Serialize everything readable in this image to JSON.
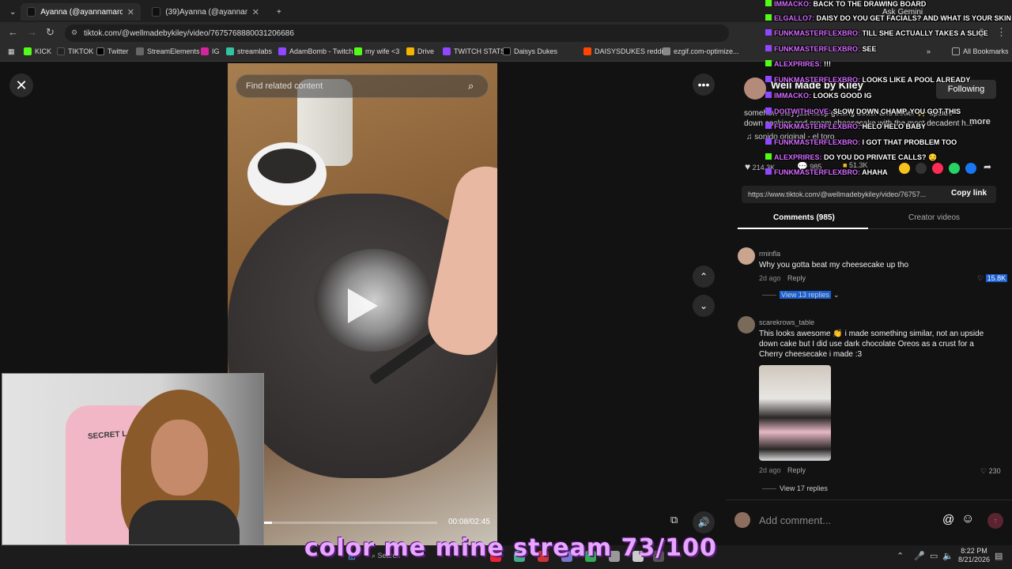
{
  "browser": {
    "tabs": [
      {
        "label": "Ayanna (@ayannamarcelin) | Ti",
        "active": true
      },
      {
        "label": "(39)Ayanna (@ayannamarcelin)",
        "active": false
      }
    ],
    "url": "tiktok.com/@wellmadebykiley/video/7675768880031206686",
    "ask_gemini": "Ask Gemini",
    "bookmarks": [
      "KICK",
      "TIKTOK",
      "Twitter",
      "StreamElements",
      "IG",
      "streamlabs",
      "AdamBomb - Twitch",
      "my wife <3",
      "Drive",
      "TWITCH STATS",
      "Daisys Dukes",
      "DAISYSDUKES reddit",
      "ezgif.com-optimize...",
      "All Bookmarks"
    ]
  },
  "video": {
    "search_placeholder": "Find related content",
    "time": "00:08/02:45",
    "progress": 0.05
  },
  "post": {
    "author": "Well Made by Kiley",
    "follow_label": "Following",
    "description": "somehow they just keep getting better and better ✨ upside-down cookies and cream cheesecake with the most decadent h...",
    "more": "more",
    "sound": "sonido original - el toro",
    "likes": "214.3K",
    "comments_count": "985",
    "saves": "51.3K",
    "link": "https://www.tiktok.com/@wellmadebykiley/video/76757...",
    "copy_link": "Copy link",
    "tab_comments": "Comments (985)",
    "tab_creator": "Creator videos"
  },
  "comments": [
    {
      "user": "rminfla",
      "text": "Why you gotta beat my cheesecake up tho",
      "date": "2d ago",
      "reply": "Reply",
      "likes": "15.8K",
      "replies": "View 13 replies"
    },
    {
      "user": "scarekrows_table",
      "text": "This looks awesome 👏 i made something similar, not an upside down cake but I did use dark chocolate Oreos as a crust for a Cherry cheesecake i made :3",
      "date": "2d ago",
      "reply": "Reply",
      "likes": "230",
      "replies": "View 17 replies"
    }
  ],
  "comment_input": {
    "placeholder": "Add comment..."
  },
  "chat": [
    {
      "name": "IMMACKO:",
      "msg": "BACK TO THE DRAWING BOARD"
    },
    {
      "name": "ELGALLO7:",
      "msg": "DAISY DO YOU GET FACIALS? AND WHAT IS YOUR SKIN CARE?"
    },
    {
      "name": "FUNKMASTERFLEXBRO:",
      "msg": "TILL SHE ACTUALLY TAKES A SLICE"
    },
    {
      "name": "FUNKMASTERFLEXBRO:",
      "msg": "SEE"
    },
    {
      "name": "ALEXPRIRES:",
      "msg": "!!!"
    },
    {
      "name": "FUNKMASTERFLEXBRO:",
      "msg": "LOOKS LIKE A POOL ALREADY"
    },
    {
      "name": "IMMACKO:",
      "msg": "LOOKS GOOD IG"
    },
    {
      "name": "DOITWITHLOVE:",
      "msg": "SLOW DOWN CHAMP, YOU GOT THIS"
    },
    {
      "name": "FUNKMASTERFLEXBRO:",
      "msg": "HELO HELO BABY"
    },
    {
      "name": "FUNKMASTERFLEXBRO:",
      "msg": "I GOT THAT PROBLEM TOO"
    },
    {
      "name": "ALEXPRIRES:",
      "msg": "DO YOU DO PRIVATE CALLS? 😏"
    },
    {
      "name": "FUNKMASTERFLEXBRO:",
      "msg": "AHAHA"
    }
  ],
  "webcam": {
    "chair_label": "SECRET LAB"
  },
  "banner": "color me mine stream 73/100",
  "taskbar": {
    "search": "Search",
    "time": "8:22 PM",
    "date": "8/21/2026"
  },
  "colors": {
    "accent": "#fe2c55",
    "chat_name": "#d66cff",
    "banner": "#e7a6ff",
    "kick_green": "#53fc18"
  }
}
